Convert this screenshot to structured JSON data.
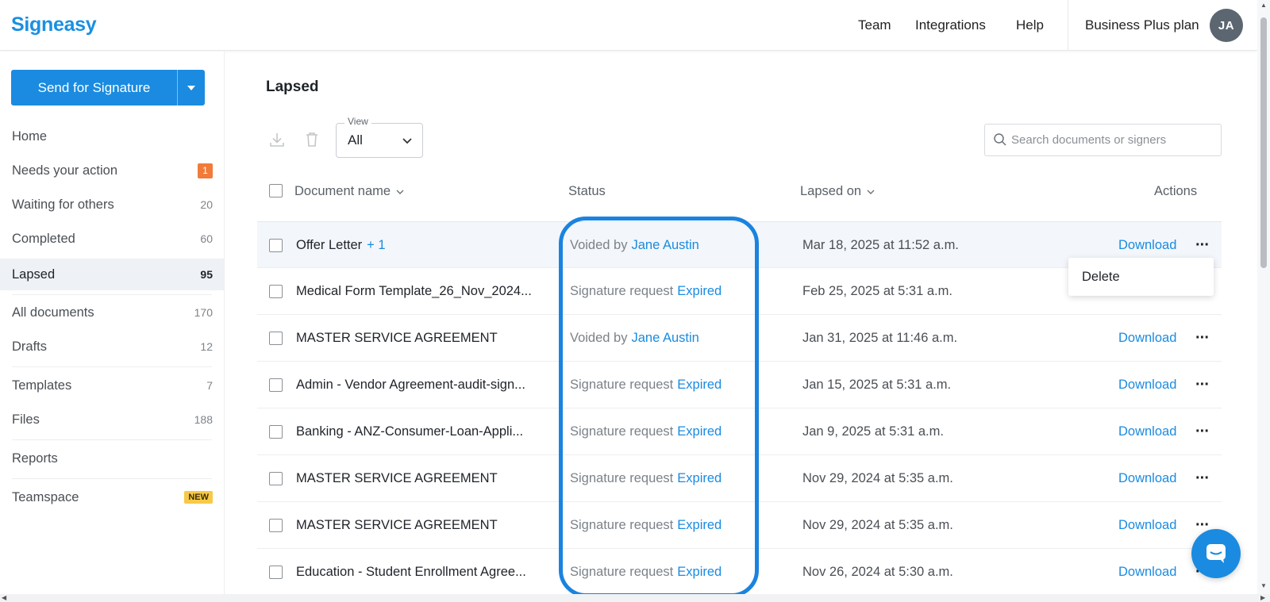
{
  "app": {
    "name": "Signeasy"
  },
  "topnav": {
    "team": "Team",
    "integrations": "Integrations",
    "help": "Help",
    "plan": "Business Plus plan",
    "avatar_initials": "JA"
  },
  "sidebar": {
    "send_button": "Send for Signature",
    "items": [
      {
        "label": "Home",
        "count": ""
      },
      {
        "label": "Needs your action",
        "count": "1"
      },
      {
        "label": "Waiting for others",
        "count": "20"
      },
      {
        "label": "Completed",
        "count": "60"
      },
      {
        "label": "Lapsed",
        "count": "95"
      },
      {
        "label": "All documents",
        "count": "170"
      },
      {
        "label": "Drafts",
        "count": "12"
      },
      {
        "label": "Templates",
        "count": "7"
      },
      {
        "label": "Files",
        "count": "188"
      },
      {
        "label": "Reports",
        "count": ""
      },
      {
        "label": "Teamspace",
        "count": "NEW"
      }
    ]
  },
  "main": {
    "title": "Lapsed",
    "view": {
      "legend": "View",
      "value": "All"
    },
    "search": {
      "placeholder": "Search documents or signers"
    },
    "columns": {
      "name": "Document name",
      "status": "Status",
      "lapsed_on": "Lapsed on",
      "actions": "Actions"
    },
    "rows": [
      {
        "name": "Offer Letter",
        "extra": "+ 1",
        "status_prefix": "Voided by",
        "status_accent": "Jane Austin",
        "date": "Mar 18, 2025 at 11:52 a.m.",
        "action": "Download"
      },
      {
        "name": "Medical Form Template_26_Nov_2024...",
        "extra": "",
        "status_prefix": "Signature request",
        "status_accent": "Expired",
        "date": "Feb 25, 2025 at 5:31 a.m.",
        "action": ""
      },
      {
        "name": "MASTER SERVICE AGREEMENT",
        "extra": "",
        "status_prefix": "Voided by",
        "status_accent": "Jane Austin",
        "date": "Jan 31, 2025 at 11:46 a.m.",
        "action": "Download"
      },
      {
        "name": "Admin - Vendor Agreement-audit-sign...",
        "extra": "",
        "status_prefix": "Signature request",
        "status_accent": "Expired",
        "date": "Jan 15, 2025 at 5:31 a.m.",
        "action": "Download"
      },
      {
        "name": "Banking - ANZ-Consumer-Loan-Appli...",
        "extra": "",
        "status_prefix": "Signature request",
        "status_accent": "Expired",
        "date": "Jan 9, 2025 at 5:31 a.m.",
        "action": "Download"
      },
      {
        "name": "MASTER SERVICE AGREEMENT",
        "extra": "",
        "status_prefix": "Signature request",
        "status_accent": "Expired",
        "date": "Nov 29, 2024 at 5:35 a.m.",
        "action": "Download"
      },
      {
        "name": "MASTER SERVICE AGREEMENT",
        "extra": "",
        "status_prefix": "Signature request",
        "status_accent": "Expired",
        "date": "Nov 29, 2024 at 5:35 a.m.",
        "action": "Download"
      },
      {
        "name": "Education - Student Enrollment Agree...",
        "extra": "",
        "status_prefix": "Signature request",
        "status_accent": "Expired",
        "date": "Nov 26, 2024 at 5:30 a.m.",
        "action": "Download"
      }
    ],
    "context_menu": {
      "delete": "Delete"
    }
  },
  "colors": {
    "brand": "#1a8be0",
    "highlight": "#1a83df",
    "badge_orange": "#f07b3a",
    "badge_new": "#f7c948"
  }
}
